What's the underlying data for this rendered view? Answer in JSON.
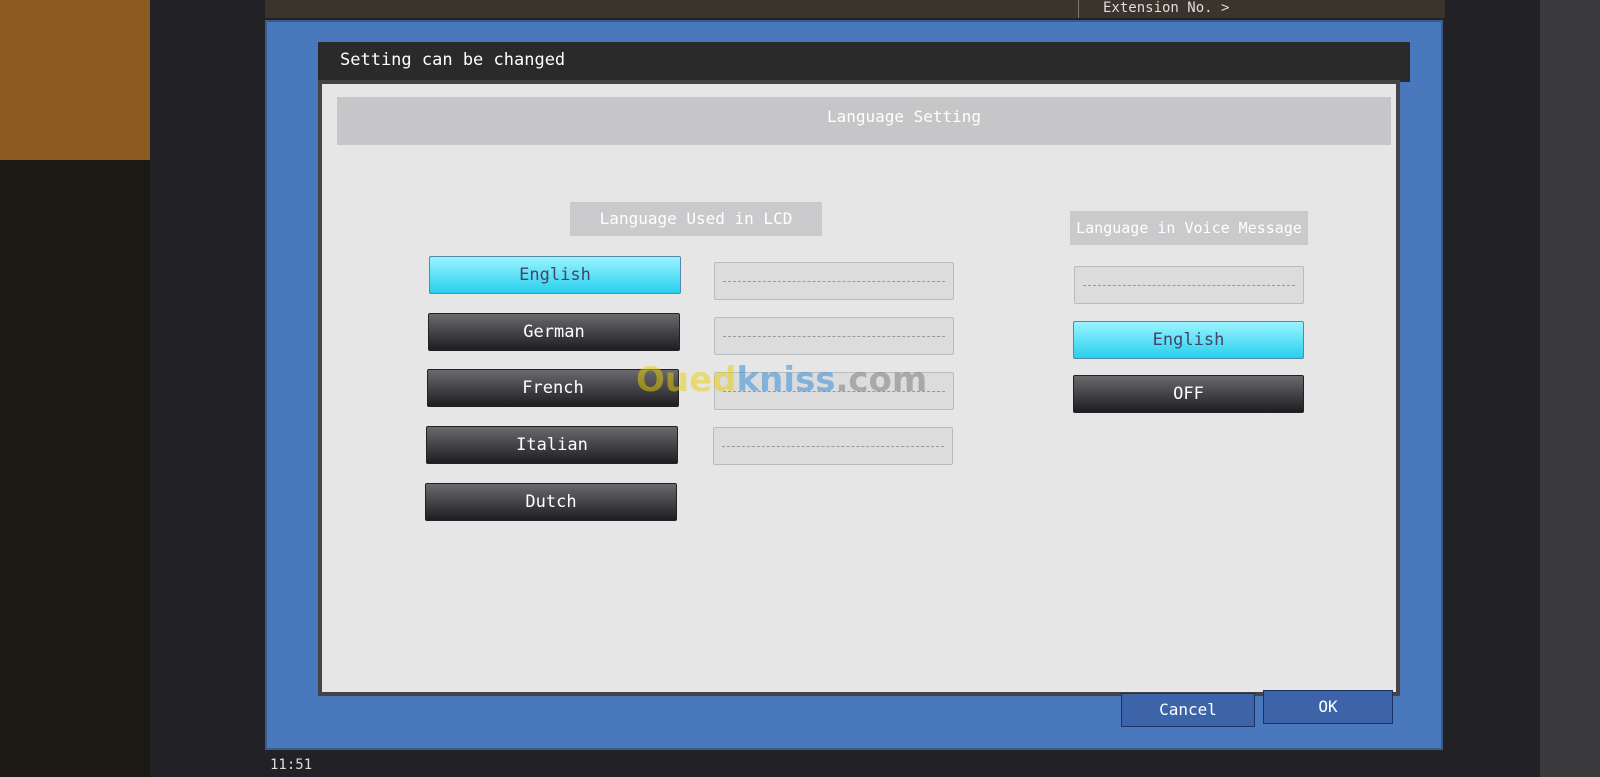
{
  "status_bar": {
    "extension": "Extension No. >",
    "clock": "11:51"
  },
  "title": "Setting can be changed",
  "header": "Language Setting",
  "lcd": {
    "label": "Language Used in LCD",
    "options": [
      {
        "label": "English",
        "selected": true
      },
      {
        "label": "German",
        "selected": false
      },
      {
        "label": "French",
        "selected": false
      },
      {
        "label": "Italian",
        "selected": false
      },
      {
        "label": "Dutch",
        "selected": false
      }
    ]
  },
  "voice": {
    "label": "Language in Voice Message",
    "options": [
      {
        "label": "English",
        "selected": true
      },
      {
        "label": "OFF",
        "selected": false
      }
    ]
  },
  "footer": {
    "cancel": "Cancel",
    "ok": "OK"
  },
  "watermark": {
    "part1": "Oued",
    "part2": "kniss",
    ".com": ".com"
  },
  "colors": {
    "selected": "#28d0ee",
    "frame": "#4a78bd"
  }
}
